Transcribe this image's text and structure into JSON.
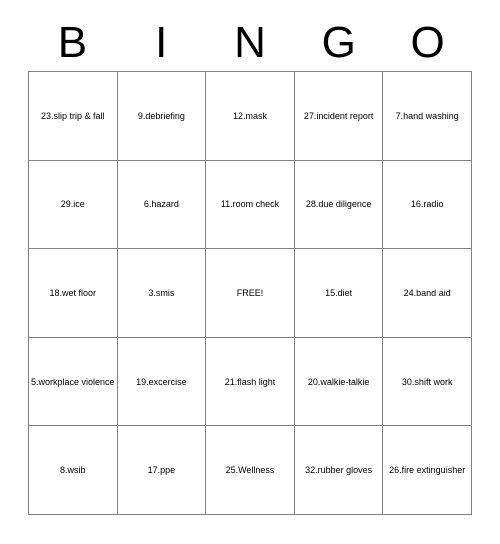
{
  "card": {
    "title": "BINGO",
    "header_letters": [
      "B",
      "I",
      "N",
      "G",
      "O"
    ],
    "free_space_label": "FREE!",
    "colors": {
      "background": "#ffffff",
      "text": "#000000",
      "grid_line": "#808080"
    },
    "grid": {
      "rows": 5,
      "columns": 5,
      "cells": [
        [
          "23.slip trip & fall",
          "9.debriefing",
          "12.mask",
          "27.incident report",
          "7.hand washing"
        ],
        [
          "29.ice",
          "6.hazard",
          "11.room check",
          "28.due diligence",
          "16.radio"
        ],
        [
          "18.wet floor",
          "3.smis",
          "FREE!",
          "15.diet",
          "24.band aid"
        ],
        [
          "5.workplace violence",
          "19.excercise",
          "21.flash light",
          "20.walkie-talkie",
          "30.shift work"
        ],
        [
          "8.wsib",
          "17.ppe",
          "25.Wellness",
          "32.rubber gloves",
          "26.fire extinguisher"
        ]
      ]
    }
  }
}
